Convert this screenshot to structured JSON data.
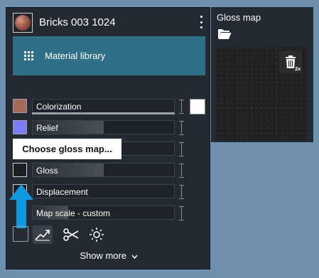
{
  "material": {
    "name": "Bricks 003 1024",
    "library_label": "Material library"
  },
  "channels": [
    {
      "label": "Colorization",
      "swatch": "#a66a5d",
      "fill": 0.0
    },
    {
      "label": "Relief",
      "swatch": "#7b7cf6",
      "fill": 0.5
    },
    {
      "label": "",
      "swatch": "#ffffff",
      "fill": 0.0
    },
    {
      "label": "Gloss",
      "swatch": "#1b1f23",
      "fill": 0.5
    },
    {
      "label": "Displacement",
      "swatch": "#1b1f23",
      "fill": 0.0
    },
    {
      "label": "Map scale - custom",
      "swatch": "",
      "fill": 0.25
    }
  ],
  "tooltip": "Choose gloss map...",
  "show_more": "Show more",
  "gloss_panel": {
    "title": "Gloss map",
    "trash_badge": "2x"
  },
  "colors": {
    "accent": "#2f6f88",
    "background": "#6f8fae",
    "panel": "#232a31",
    "arrow": "#0f9ae0"
  },
  "icons": [
    "grid-icon",
    "kebab-icon",
    "folder-open-icon",
    "trash-icon",
    "curve-icon",
    "scissors-icon",
    "sun-icon",
    "chevron-down-icon"
  ]
}
